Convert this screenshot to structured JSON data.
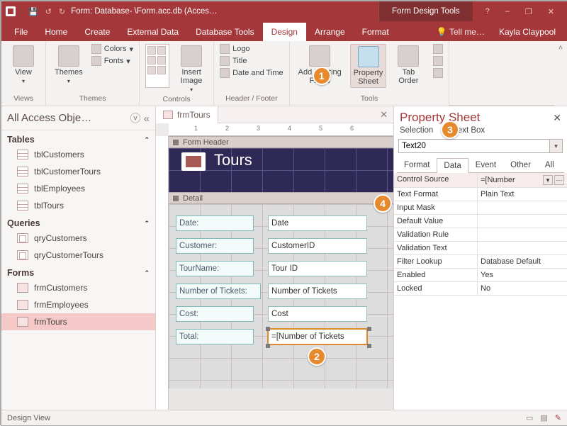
{
  "titlebar": {
    "app_title": "Form: Database- \\Form.acc.db (Acces…",
    "context_tab": "Form Design Tools"
  },
  "ribbon_tabs": {
    "file": "File",
    "home": "Home",
    "create": "Create",
    "external": "External Data",
    "dbtools": "Database Tools",
    "design": "Design",
    "arrange": "Arrange",
    "format": "Format",
    "tell": "Tell me…",
    "user": "Kayla Claypool"
  },
  "ribbon": {
    "views": {
      "label": "Views",
      "view_btn": "View"
    },
    "themes": {
      "label": "Themes",
      "themes_btn": "Themes",
      "colors": "Colors",
      "fonts": "Fonts"
    },
    "controls": {
      "label": "Controls",
      "controls_btn": "Controls",
      "insert_image": "Insert\nImage"
    },
    "headerfooter": {
      "label": "Header / Footer",
      "logo": "Logo",
      "title": "Title",
      "datetime": "Date and Time"
    },
    "tools": {
      "label": "Tools",
      "add_fields": "Add Existing\nFields",
      "prop_sheet": "Property\nSheet",
      "tab_order": "Tab\nOrder"
    }
  },
  "nav": {
    "header": "All Access Obje…",
    "tables_hdr": "Tables",
    "tables": [
      "tblCustomers",
      "tblCustomerTours",
      "tblEmployees",
      "tblTours"
    ],
    "queries_hdr": "Queries",
    "queries": [
      "qryCustomers",
      "qryCustomerTours"
    ],
    "forms_hdr": "Forms",
    "forms": [
      "frmCustomers",
      "frmEmployees",
      "frmTours"
    ]
  },
  "doc": {
    "tab_name": "frmTours",
    "form_header_bar": "Form Header",
    "detail_bar": "Detail",
    "header_title": "Tours",
    "labels": {
      "date": "Date:",
      "customer": "Customer:",
      "tourname": "TourName:",
      "tickets": "Number of Tickets:",
      "cost": "Cost:",
      "total": "Total:"
    },
    "fields": {
      "date": "Date",
      "customer": "CustomerID",
      "tourname": "Tour ID",
      "tickets": "Number of Tickets",
      "cost": "Cost",
      "total": "=[Number of Tickets"
    }
  },
  "ruler_marks": [
    "1",
    "2",
    "3",
    "4",
    "5",
    "6"
  ],
  "prop": {
    "title": "Property Sheet",
    "sel_type_prefix": "Selection",
    "sel_type_suffix": "Text Box",
    "selector_value": "Text20",
    "tabs": {
      "format": "Format",
      "data": "Data",
      "event": "Event",
      "other": "Other",
      "all": "All"
    },
    "rows": {
      "control_source": {
        "n": "Control Source",
        "v": "=[Number"
      },
      "text_format": {
        "n": "Text Format",
        "v": "Plain Text"
      },
      "input_mask": {
        "n": "Input Mask",
        "v": ""
      },
      "default_value": {
        "n": "Default Value",
        "v": ""
      },
      "validation_rule": {
        "n": "Validation Rule",
        "v": ""
      },
      "validation_text": {
        "n": "Validation Text",
        "v": ""
      },
      "filter_lookup": {
        "n": "Filter Lookup",
        "v": "Database Default"
      },
      "enabled": {
        "n": "Enabled",
        "v": "Yes"
      },
      "locked": {
        "n": "Locked",
        "v": "No"
      }
    }
  },
  "status": {
    "left": "Design View"
  },
  "callouts": {
    "1": "1",
    "2": "2",
    "3": "3",
    "4": "4"
  }
}
